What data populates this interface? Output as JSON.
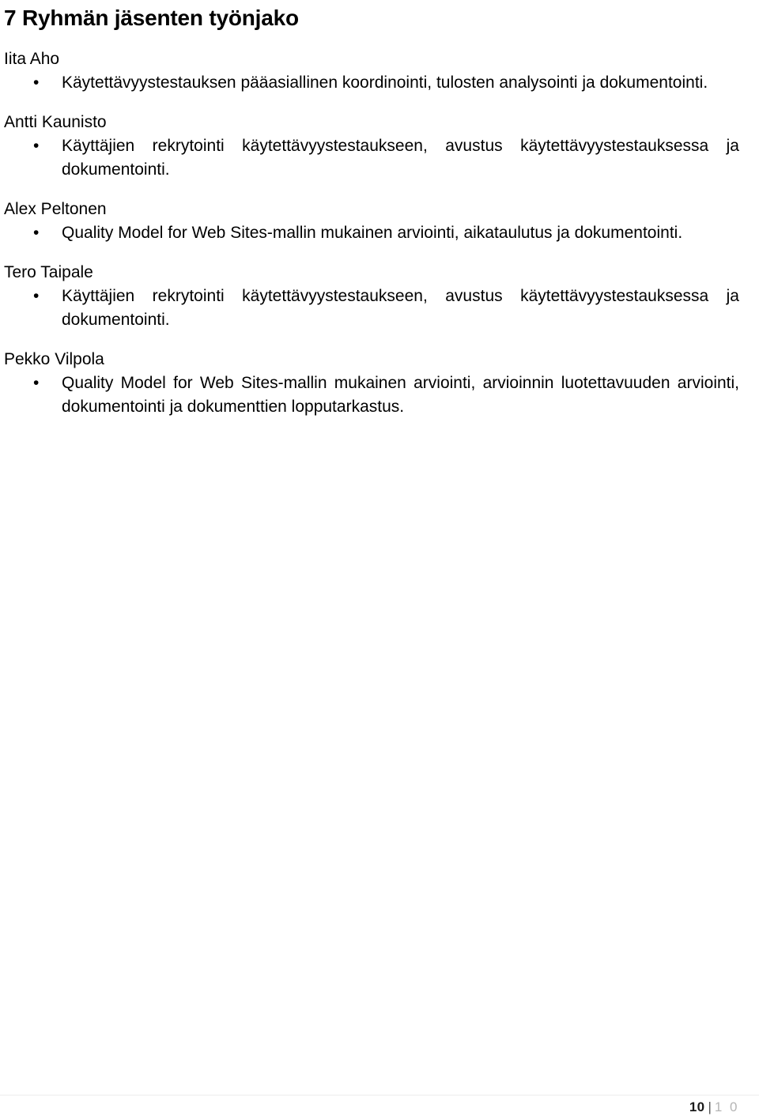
{
  "document": {
    "heading": "7 Ryhmän jäsenten työnjako",
    "members": [
      {
        "name": "Iita Aho",
        "tasks": [
          "Käytettävyystestauksen pääasiallinen koordinointi, tulosten analysointi ja dokumentointi."
        ]
      },
      {
        "name": "Antti Kaunisto",
        "tasks": [
          "Käyttäjien rekrytointi käytettävyystestaukseen, avustus käytettävyystestauksessa ja dokumentointi."
        ]
      },
      {
        "name": "Alex Peltonen",
        "tasks": [
          "Quality Model for Web Sites-mallin mukainen arviointi, aikataulutus ja dokumentointi."
        ]
      },
      {
        "name": "Tero Taipale",
        "tasks": [
          "Käyttäjien rekrytointi käytettävyystestaukseen, avustus käytettävyystestauksessa ja dokumentointi."
        ]
      },
      {
        "name": "Pekko Vilpola",
        "tasks": [
          "Quality Model for Web Sites-mallin mukainen arviointi, arvioinnin luotettavuuden arviointi, dokumentointi ja dokumenttien lopputarkastus."
        ]
      }
    ]
  },
  "footer": {
    "page_current": "10",
    "separator": "|",
    "page_total": "1 0",
    "bullet_glyph": "•"
  }
}
